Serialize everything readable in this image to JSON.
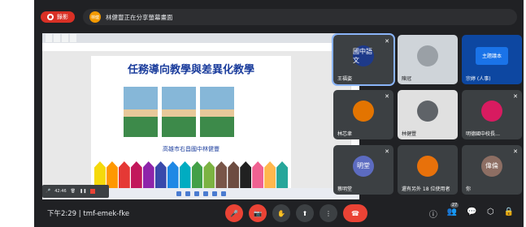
{
  "recording": {
    "label": "錄影"
  },
  "presenter_banner": {
    "avatar_text": "林健",
    "text": "林健豐正在分享螢幕畫面"
  },
  "slide": {
    "title": "任務導向教學與差異化教學",
    "subtitle": "高雄市右昌國中林健豐"
  },
  "mini_bar": {
    "time": "42:46"
  },
  "participants": [
    {
      "name": "王福姿",
      "avatar": "國中語文",
      "color": "#1e3a8a"
    },
    {
      "name": "陳冠",
      "avatar": "",
      "color": "#9aa0a6"
    },
    {
      "name": "宗婷 (人事)",
      "avatar": "主題議本",
      "color": "#1a73e8"
    },
    {
      "name": "林芯聿",
      "avatar": "",
      "color": "#e37400"
    },
    {
      "name": "林健豐",
      "avatar": "",
      "color": "#5f6368"
    },
    {
      "name": "明德國中校長…",
      "avatar": "",
      "color": "#d81b60"
    },
    {
      "name": "蔡明堂",
      "avatar": "明堂",
      "color": "#5c6bc0"
    },
    {
      "name": "還有另外 18 位使用者",
      "avatar": "",
      "color": "#e8710a"
    },
    {
      "name": "你",
      "avatar": "偉倫",
      "color": "#8d6e63"
    }
  ],
  "bottom_bar": {
    "time": "下午2:29",
    "meeting_code": "tmf-emek-fke",
    "participant_count": "27"
  }
}
